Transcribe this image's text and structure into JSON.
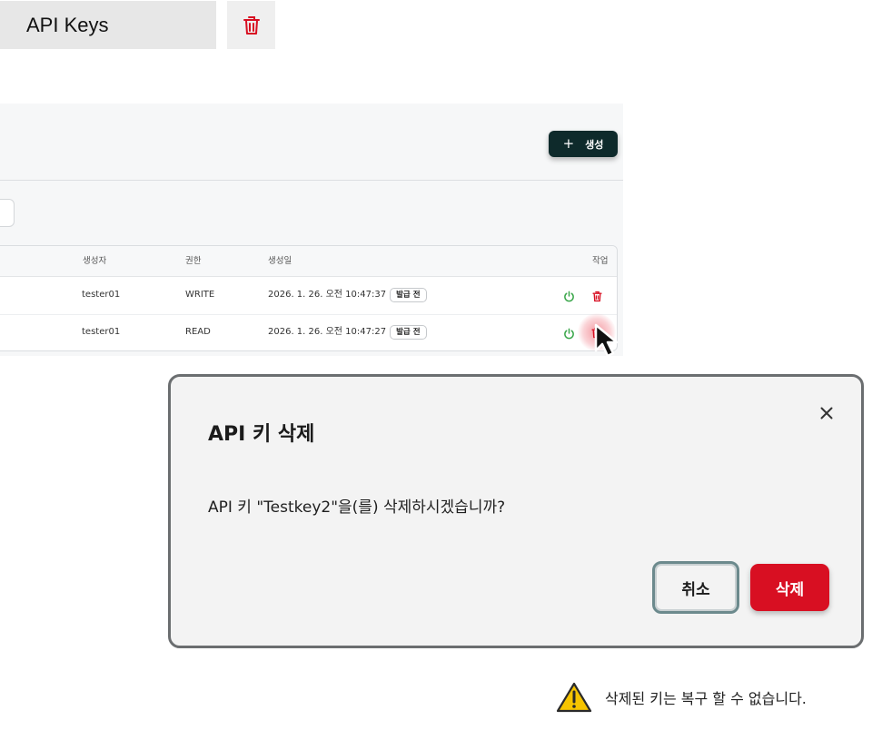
{
  "header": {
    "title": "API Keys",
    "delete_icon": "trash-icon"
  },
  "toolbar": {
    "create_label": "생성",
    "create_icon": "plus-icon"
  },
  "table": {
    "columns": [
      "생성자",
      "권한",
      "생성일",
      "작업"
    ],
    "rows": [
      {
        "creator": "tester01",
        "permission": "WRITE",
        "created": "2026. 1. 26. 오전 10:47:37",
        "status": "발급 전"
      },
      {
        "creator": "tester01",
        "permission": "READ",
        "created": "2026. 1. 26. 오전 10:47:27",
        "status": "발급 전"
      }
    ],
    "action_icons": [
      "power-icon",
      "trash-icon"
    ]
  },
  "dialog": {
    "title": "API 키 삭제",
    "message": "API 키 \"Testkey2\"을(를) 삭제하시겠습니까?",
    "cancel_label": "취소",
    "confirm_label": "삭제",
    "close_icon": "close-icon"
  },
  "warning": {
    "text": "삭제된 키는 복구 할 수 없습니다.",
    "icon": "warning-triangle-icon"
  },
  "colors": {
    "accent_dark": "#0e2a2b",
    "danger": "#d80f22",
    "success": "#3aa64a",
    "warning_yellow": "#f6c400"
  }
}
